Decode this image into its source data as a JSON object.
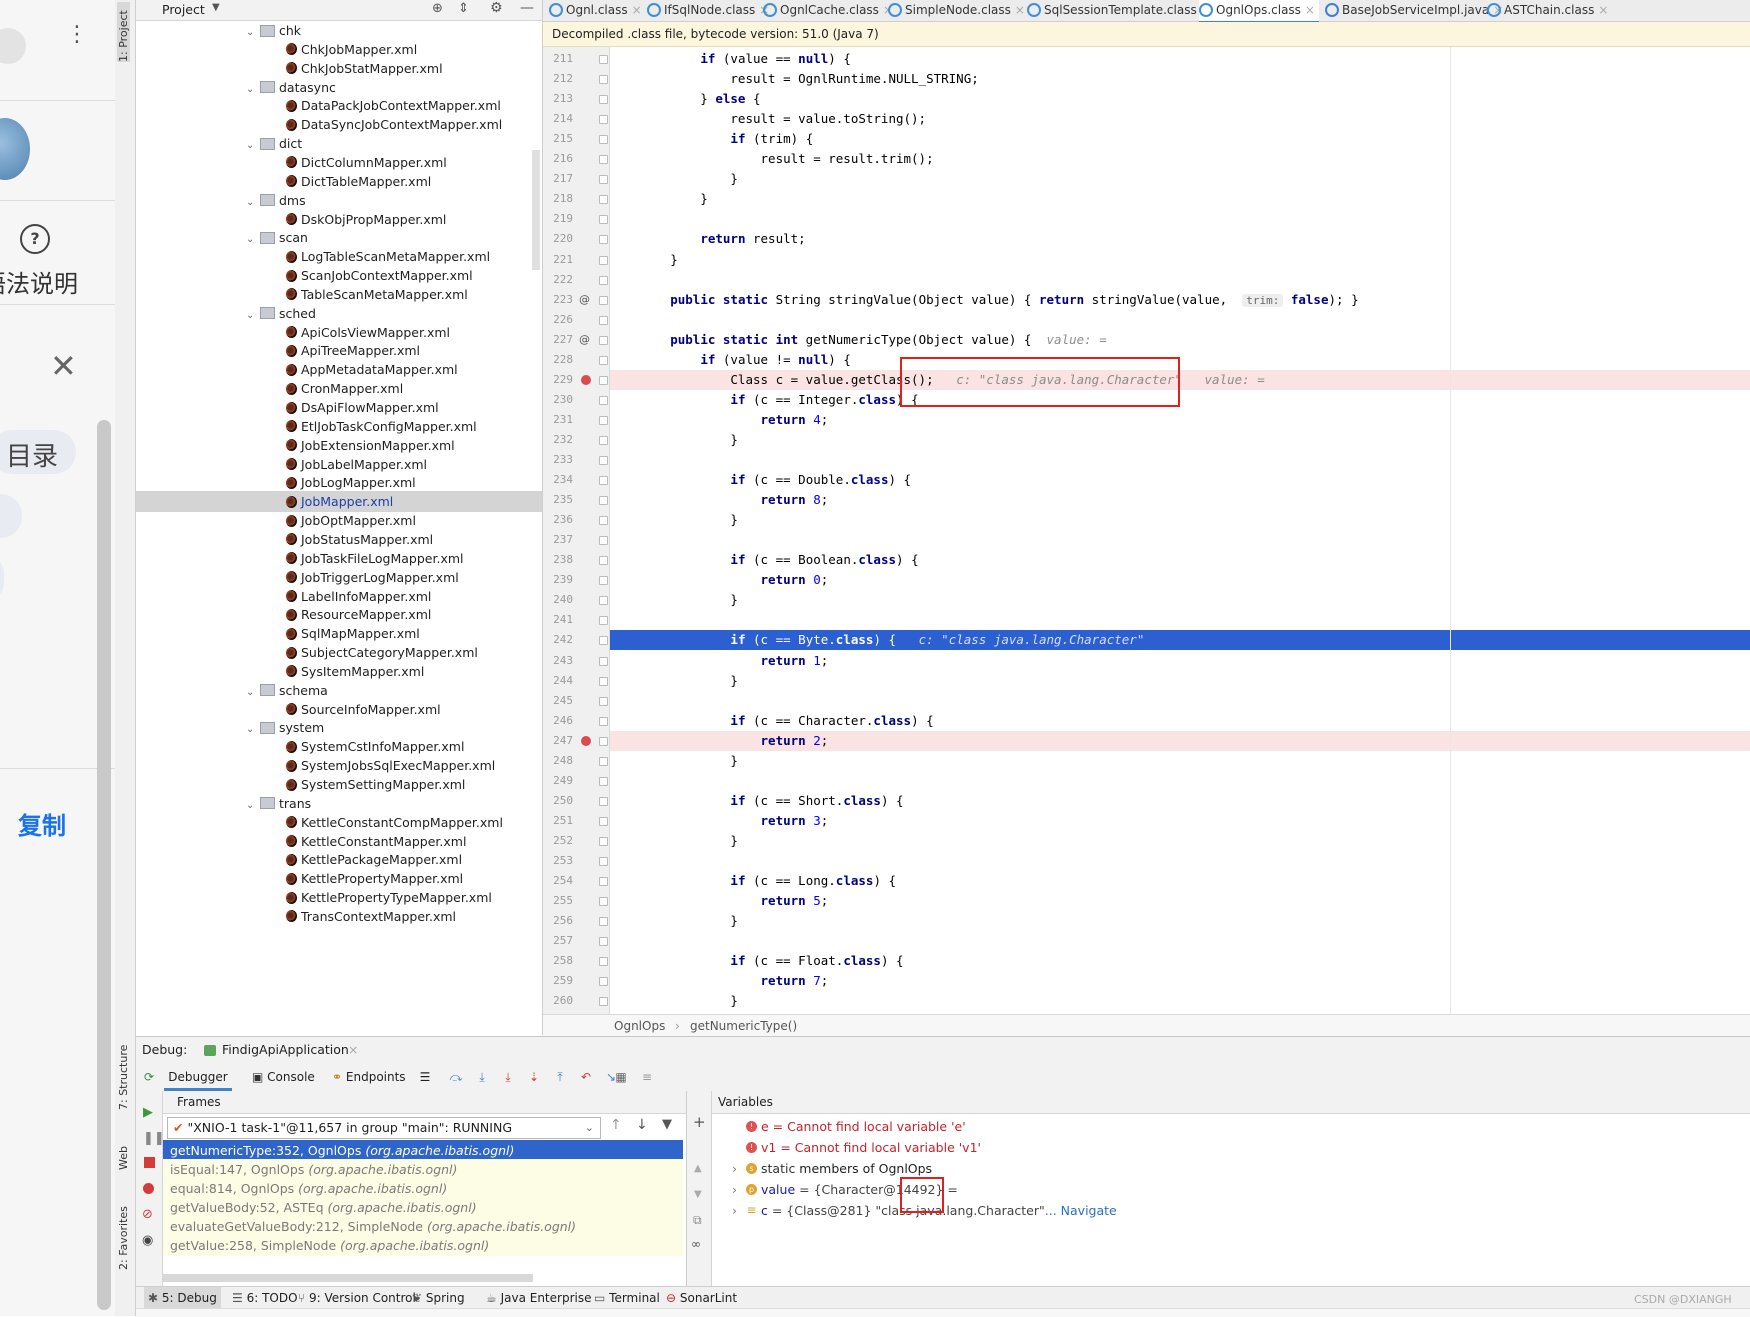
{
  "browser": {
    "help_label": "语法说明",
    "toc_label": "目录",
    "copy_label": "复制"
  },
  "side_tabs": {
    "project": "1: Project",
    "structure": "7: Structure",
    "web": "Web",
    "favorites": "2: Favorites"
  },
  "project": {
    "title": "Project",
    "tree": [
      {
        "label": "chk",
        "type": "folder"
      },
      {
        "label": "ChkJobMapper.xml",
        "type": "file"
      },
      {
        "label": "ChkJobStatMapper.xml",
        "type": "file"
      },
      {
        "label": "datasync",
        "type": "folder"
      },
      {
        "label": "DataPackJobContextMapper.xml",
        "type": "file"
      },
      {
        "label": "DataSyncJobContextMapper.xml",
        "type": "file"
      },
      {
        "label": "dict",
        "type": "folder"
      },
      {
        "label": "DictColumnMapper.xml",
        "type": "file"
      },
      {
        "label": "DictTableMapper.xml",
        "type": "file"
      },
      {
        "label": "dms",
        "type": "folder"
      },
      {
        "label": "DskObjPropMapper.xml",
        "type": "file"
      },
      {
        "label": "scan",
        "type": "folder"
      },
      {
        "label": "LogTableScanMetaMapper.xml",
        "type": "file"
      },
      {
        "label": "ScanJobContextMapper.xml",
        "type": "file"
      },
      {
        "label": "TableScanMetaMapper.xml",
        "type": "file"
      },
      {
        "label": "sched",
        "type": "folder"
      },
      {
        "label": "ApiColsViewMapper.xml",
        "type": "file"
      },
      {
        "label": "ApiTreeMapper.xml",
        "type": "file"
      },
      {
        "label": "AppMetadataMapper.xml",
        "type": "file"
      },
      {
        "label": "CronMapper.xml",
        "type": "file"
      },
      {
        "label": "DsApiFlowMapper.xml",
        "type": "file"
      },
      {
        "label": "EtlJobTaskConfigMapper.xml",
        "type": "file"
      },
      {
        "label": "JobExtensionMapper.xml",
        "type": "file"
      },
      {
        "label": "JobLabelMapper.xml",
        "type": "file"
      },
      {
        "label": "JobLogMapper.xml",
        "type": "file"
      },
      {
        "label": "JobMapper.xml",
        "type": "file",
        "selected": true
      },
      {
        "label": "JobOptMapper.xml",
        "type": "file"
      },
      {
        "label": "JobStatusMapper.xml",
        "type": "file"
      },
      {
        "label": "JobTaskFileLogMapper.xml",
        "type": "file"
      },
      {
        "label": "JobTriggerLogMapper.xml",
        "type": "file"
      },
      {
        "label": "LabelInfoMapper.xml",
        "type": "file"
      },
      {
        "label": "ResourceMapper.xml",
        "type": "file"
      },
      {
        "label": "SqlMapMapper.xml",
        "type": "file"
      },
      {
        "label": "SubjectCategoryMapper.xml",
        "type": "file"
      },
      {
        "label": "SysItemMapper.xml",
        "type": "file"
      },
      {
        "label": "schema",
        "type": "folder"
      },
      {
        "label": "SourceInfoMapper.xml",
        "type": "file"
      },
      {
        "label": "system",
        "type": "folder"
      },
      {
        "label": "SystemCstInfoMapper.xml",
        "type": "file"
      },
      {
        "label": "SystemJobsSqlExecMapper.xml",
        "type": "file"
      },
      {
        "label": "SystemSettingMapper.xml",
        "type": "file"
      },
      {
        "label": "trans",
        "type": "folder"
      },
      {
        "label": "KettleConstantCompMapper.xml",
        "type": "file"
      },
      {
        "label": "KettleConstantMapper.xml",
        "type": "file"
      },
      {
        "label": "KettlePackageMapper.xml",
        "type": "file"
      },
      {
        "label": "KettlePropertyMapper.xml",
        "type": "file"
      },
      {
        "label": "KettlePropertyTypeMapper.xml",
        "type": "file"
      },
      {
        "label": "TransContextMapper.xml",
        "type": "file"
      }
    ]
  },
  "editor": {
    "tabs": [
      {
        "label": "Ognl.class",
        "active": false
      },
      {
        "label": "IfSqlNode.class",
        "active": false
      },
      {
        "label": "OgnlCache.class",
        "active": false
      },
      {
        "label": "SimpleNode.class",
        "active": false
      },
      {
        "label": "SqlSessionTemplate.class",
        "active": false
      },
      {
        "label": "OgnlOps.class",
        "active": true
      },
      {
        "label": "BaseJobServiceImpl.java",
        "active": false
      },
      {
        "label": "ASTChain.class",
        "active": false
      }
    ],
    "decompiled_notice": "Decompiled .class file, bytecode version: 51.0 (Java 7)",
    "lines": [
      {
        "n": "211",
        "html": "            <span class=\"kw\">if</span> (value == <span class=\"kw\">null</span>) {"
      },
      {
        "n": "212",
        "html": "                result = OgnlRuntime.NULL_STRING;"
      },
      {
        "n": "213",
        "html": "            } <span class=\"kw\">else</span> {"
      },
      {
        "n": "214",
        "html": "                result = value.toString();"
      },
      {
        "n": "215",
        "html": "                <span class=\"kw\">if</span> (trim) {"
      },
      {
        "n": "216",
        "html": "                    result = result.trim();"
      },
      {
        "n": "217",
        "html": "                }"
      },
      {
        "n": "218",
        "html": "            }"
      },
      {
        "n": "219",
        "html": ""
      },
      {
        "n": "220",
        "html": "            <span class=\"kw\">return</span> result;"
      },
      {
        "n": "221",
        "html": "        }"
      },
      {
        "n": "222",
        "html": ""
      },
      {
        "n": "223",
        "html": "        <span class=\"kw\">public static</span> String stringValue(Object value) { <span class=\"kw\">return</span> stringValue(value,  <span class=\"hint-chip\">trim:</span> <span class=\"kw\">false</span>); }"
      },
      {
        "n": "226",
        "html": ""
      },
      {
        "n": "227",
        "html": "        <span class=\"kw\">public static int</span> getNumericType(Object value) {  <span class=\"hint\">value: =</span>"
      },
      {
        "n": "228",
        "html": "            <span class=\"kw\">if</span> (value != <span class=\"kw\">null</span>) {"
      },
      {
        "n": "229",
        "html": "                Class c = value.getClass();   <span class=\"hint\">c: \"class java.lang.Character\"   value: =</span>",
        "bp": true
      },
      {
        "n": "230",
        "html": "                <span class=\"kw\">if</span> (c == Integer.<span class=\"kw\">class</span>) {"
      },
      {
        "n": "231",
        "html": "                    <span class=\"kw\">return</span> <span class=\"num\">4</span>;"
      },
      {
        "n": "232",
        "html": "                }"
      },
      {
        "n": "233",
        "html": ""
      },
      {
        "n": "234",
        "html": "                <span class=\"kw\">if</span> (c == Double.<span class=\"kw\">class</span>) {"
      },
      {
        "n": "235",
        "html": "                    <span class=\"kw\">return</span> <span class=\"num\">8</span>;"
      },
      {
        "n": "236",
        "html": "                }"
      },
      {
        "n": "237",
        "html": ""
      },
      {
        "n": "238",
        "html": "                <span class=\"kw\">if</span> (c == Boolean.<span class=\"kw\">class</span>) {"
      },
      {
        "n": "239",
        "html": "                    <span class=\"kw\">return</span> <span class=\"num\">0</span>;"
      },
      {
        "n": "240",
        "html": "                }"
      },
      {
        "n": "241",
        "html": ""
      },
      {
        "n": "242",
        "html": "                <span class=\"kw\">if</span> (c == Byte.<span class=\"kw\">class</span>) {   <span class=\"hint\">c: \"class java.lang.Character\"</span>",
        "exec": true
      },
      {
        "n": "243",
        "html": "                    <span class=\"kw\">return</span> <span class=\"num\">1</span>;"
      },
      {
        "n": "244",
        "html": "                }"
      },
      {
        "n": "245",
        "html": ""
      },
      {
        "n": "246",
        "html": "                <span class=\"kw\">if</span> (c == Character.<span class=\"kw\">class</span>) {"
      },
      {
        "n": "247",
        "html": "                    <span class=\"kw\">return</span> <span class=\"num\">2</span>;",
        "bp": true
      },
      {
        "n": "248",
        "html": "                }"
      },
      {
        "n": "249",
        "html": ""
      },
      {
        "n": "250",
        "html": "                <span class=\"kw\">if</span> (c == Short.<span class=\"kw\">class</span>) {"
      },
      {
        "n": "251",
        "html": "                    <span class=\"kw\">return</span> <span class=\"num\">3</span>;"
      },
      {
        "n": "252",
        "html": "                }"
      },
      {
        "n": "253",
        "html": ""
      },
      {
        "n": "254",
        "html": "                <span class=\"kw\">if</span> (c == Long.<span class=\"kw\">class</span>) {"
      },
      {
        "n": "255",
        "html": "                    <span class=\"kw\">return</span> <span class=\"num\">5</span>;"
      },
      {
        "n": "256",
        "html": "                }"
      },
      {
        "n": "257",
        "html": ""
      },
      {
        "n": "258",
        "html": "                <span class=\"kw\">if</span> (c == Float.<span class=\"kw\">class</span>) {"
      },
      {
        "n": "259",
        "html": "                    <span class=\"kw\">return</span> <span class=\"num\">7</span>;"
      },
      {
        "n": "260",
        "html": "                }"
      }
    ],
    "breadcrumb": [
      "OgnlOps",
      "getNumericType()"
    ]
  },
  "debug": {
    "label": "Debug:",
    "config_name": "FindigApiApplication",
    "tabs": [
      "Debugger",
      "Console",
      "Endpoints"
    ],
    "frames_title": "Frames",
    "thread": "\"XNIO-1 task-1\"@11,657 in group \"main\": RUNNING",
    "frames": [
      {
        "method": "getNumericType:352, OgnlOps",
        "pkg": "(org.apache.ibatis.ognl)",
        "selected": true
      },
      {
        "method": "isEqual:147, OgnlOps",
        "pkg": "(org.apache.ibatis.ognl)"
      },
      {
        "method": "equal:814, OgnlOps",
        "pkg": "(org.apache.ibatis.ognl)"
      },
      {
        "method": "getValueBody:52, ASTEq",
        "pkg": "(org.apache.ibatis.ognl)"
      },
      {
        "method": "evaluateGetValueBody:212, SimpleNode",
        "pkg": "(org.apache.ibatis.ognl)"
      },
      {
        "method": "getValue:258, SimpleNode",
        "pkg": "(org.apache.ibatis.ognl)"
      }
    ],
    "variables_title": "Variables",
    "variables": [
      {
        "icon": "error-icon",
        "text": "e = Cannot find local variable 'e'",
        "error": true
      },
      {
        "icon": "error-icon",
        "text": "v1 = Cannot find local variable 'v1'",
        "error": true
      },
      {
        "icon": "static-icon",
        "name": "static",
        "text": " members of OgnlOps"
      },
      {
        "icon": "param-icon",
        "name": "value",
        "text": " = {Character@14492} ="
      },
      {
        "icon": "field-icon",
        "name": "c",
        "text": " = {Class@281} \"class java.lang.Character\"",
        "link": "... Navigate"
      }
    ]
  },
  "status_bar": [
    "5: Debug",
    "6: TODO",
    "9: Version Control",
    "Spring",
    "Java Enterprise",
    "Terminal",
    "SonarLint"
  ],
  "watermark": "CSDN @DXIANGH",
  "colors": {
    "accent": "#2c5fcf",
    "breakpoint": "#db4b4b",
    "annotation_box": "#e0201c"
  }
}
